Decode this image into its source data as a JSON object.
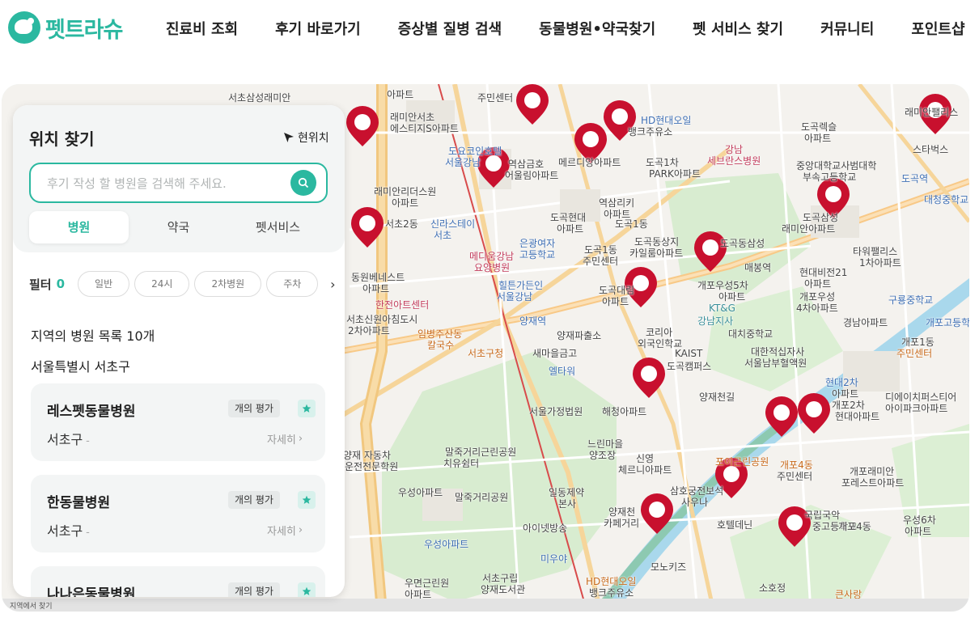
{
  "logo": {
    "text": "펫트라슈"
  },
  "nav": [
    "진료비 조회",
    "후기 바로가기",
    "증상별 질병 검색",
    "동물병원•약국찾기",
    "펫 서비스 찾기",
    "커뮤니티",
    "포인트샵"
  ],
  "sidebar": {
    "title": "위치 찾기",
    "current_location": "현위치",
    "search_placeholder": "후기 작성 할 병원을 검색해 주세요.",
    "tabs": [
      "병원",
      "약국",
      "펫서비스"
    ],
    "active_tab": "병원",
    "filter": {
      "label": "필터",
      "count": "0",
      "chips": [
        "일반",
        "24시",
        "2차병원",
        "주차"
      ]
    },
    "list_header": "지역의 병원 목록 10개",
    "region": "서울특별시 서초구",
    "cards": [
      {
        "name": "레스펫동물병원",
        "badge": "개의 평가",
        "area": "서초구",
        "dash": "-",
        "detail": "자세히"
      },
      {
        "name": "한동물병원",
        "badge": "개의 평가",
        "area": "서초구",
        "dash": "-",
        "detail": "자세히"
      },
      {
        "name": "나나은동물병원",
        "badge": "개의 평가",
        "area": "",
        "dash": "",
        "detail": ""
      }
    ]
  },
  "map": {
    "footer": "지역에서 찾기",
    "pin_color": "#c8102e",
    "accent": "#2bb8a0",
    "labels": [
      "서초삼성래미안",
      "아파트",
      "주민센터",
      "래미안서초",
      "에스티지S아파트",
      "HD현대오일",
      "뱅크주유소",
      "도곡렉슬",
      "아파트",
      "래미안팰리스",
      "스타벅스",
      "도요코인호텔",
      "서울강남",
      "역삼금호",
      "어울림아파트",
      "메르디앙아파트",
      "도곡1차",
      "PARK아파트",
      "강남",
      "세브란스병원",
      "중앙대학교사범대학",
      "부속고등학교",
      "도곡역",
      "대청중학교",
      "래미안리더스원",
      "아파트",
      "역삼리키",
      "아파트",
      "도곡1동",
      "도곡삼성",
      "래미안아파트",
      "서초2동",
      "신라스테이",
      "서초",
      "도곡현대",
      "아파트",
      "타워팰리스",
      "1차아파트",
      "은광여자",
      "고등학교",
      "메디움강남",
      "요양병원",
      "도곡1동",
      "주민센터",
      "도곡동상지",
      "카일룸아파트",
      "도곡동삼성",
      "매봉역",
      "현대비전21",
      "아파트",
      "동원베네스트",
      "아파트",
      "힐튼가든인",
      "서울강남",
      "도곡대림",
      "아파트",
      "개포우성5차",
      "아파트",
      "개포우성",
      "4차아파트",
      "구룡중학교",
      "한전아트센터",
      "양재역",
      "KT&G",
      "강남지사",
      "대치중학교",
      "경남아파트",
      "개포고등학교",
      "서초신원아침도시",
      "2차아파트",
      "임병주산동",
      "칼국수",
      "양재파출소",
      "코리아",
      "외국인학교",
      "개포1동",
      "주민센터",
      "서초구청",
      "새마을금고",
      "KAIST",
      "도곡캠퍼스",
      "대한적십자사",
      "서울남부혈액원",
      "엘타워",
      "현대2차",
      "아파트",
      "양재천길",
      "디에이치퍼스티어",
      "아이파크아파트",
      "서울가정법원",
      "해청아파트",
      "개포2차",
      "현대아파트",
      "양재 자동차",
      "운전전문학원",
      "말죽거리근린공원",
      "치유쉼터",
      "느린마을",
      "양조장",
      "신영",
      "체르니아파트",
      "포이근린공원",
      "개포4동",
      "주민센터",
      "개포래미안",
      "포레스트아파트",
      "우성아파트",
      "말죽거리공원",
      "일동제약",
      "본사",
      "삼호궁전보석",
      "사우나",
      "아이넷방송",
      "양재천",
      "카페거리",
      "호텔데닌",
      "국립국악",
      "중고등학교",
      "개포4동",
      "우성6차",
      "아파트",
      "우성아파트",
      "미우야",
      "모노키즈",
      "서초구립",
      "양재도서관",
      "우면근린원",
      "아파트",
      "HD현대오일",
      "뱅크주유소",
      "소호정",
      "큰사랑"
    ]
  }
}
